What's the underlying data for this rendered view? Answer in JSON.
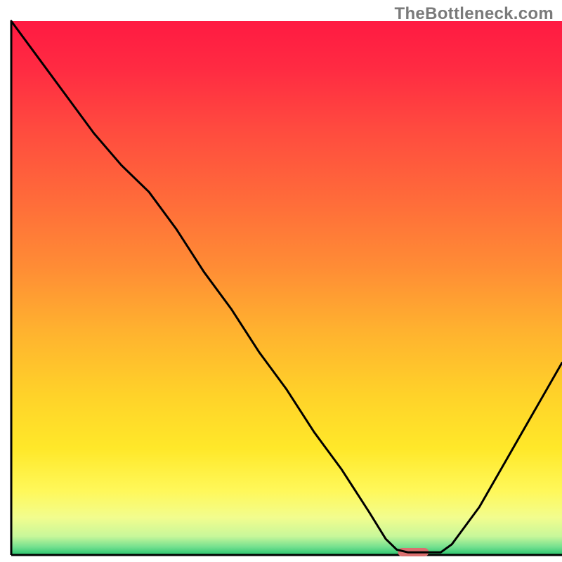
{
  "watermark": "TheBottleneck.com",
  "chart_data": {
    "type": "line",
    "title": "",
    "xlabel": "",
    "ylabel": "",
    "xlim": [
      0,
      100
    ],
    "ylim": [
      0,
      100
    ],
    "x": [
      0,
      5,
      10,
      15,
      20,
      25,
      30,
      35,
      40,
      45,
      50,
      55,
      60,
      65,
      68,
      70,
      72,
      75,
      78,
      80,
      85,
      90,
      95,
      100
    ],
    "y": [
      100,
      93,
      86,
      79,
      73,
      68,
      61,
      53,
      46,
      38,
      31,
      23,
      16,
      8,
      3,
      1,
      0.5,
      0.5,
      0.5,
      2,
      9,
      18,
      27,
      36
    ],
    "optimum_marker": {
      "x_center": 73,
      "x_halfwidth": 2.8,
      "color": "#da6f6f"
    },
    "gradient_stops": [
      {
        "pos": 0.0,
        "color": "#ff1a42"
      },
      {
        "pos": 0.09,
        "color": "#ff2b42"
      },
      {
        "pos": 0.2,
        "color": "#ff4a3f"
      },
      {
        "pos": 0.33,
        "color": "#ff6a3a"
      },
      {
        "pos": 0.46,
        "color": "#ff8c35"
      },
      {
        "pos": 0.58,
        "color": "#ffb22f"
      },
      {
        "pos": 0.7,
        "color": "#ffd229"
      },
      {
        "pos": 0.8,
        "color": "#ffe829"
      },
      {
        "pos": 0.88,
        "color": "#fff85a"
      },
      {
        "pos": 0.93,
        "color": "#f2fd8e"
      },
      {
        "pos": 0.965,
        "color": "#c8f79a"
      },
      {
        "pos": 0.985,
        "color": "#74e08f"
      },
      {
        "pos": 1.0,
        "color": "#28c46e"
      }
    ],
    "axis_color": "#000000",
    "curve_color": "#000000"
  }
}
